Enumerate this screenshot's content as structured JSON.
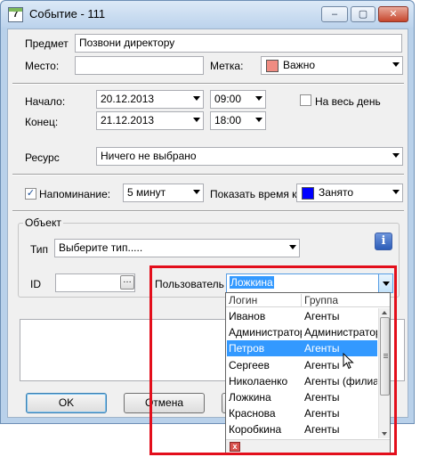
{
  "window": {
    "icon_text": "7",
    "title": "Событие - 111",
    "min_glyph": "–",
    "max_glyph": "▢",
    "close_glyph": "✕"
  },
  "form": {
    "subject_label": "Предмет",
    "subject_value": "Позвони директору",
    "place_label": "Место:",
    "place_value": "",
    "tag_label": "Метка:",
    "tag_value": "Важно",
    "start_label": "Начало:",
    "start_date": "20.12.2013",
    "start_time": "09:00",
    "end_label": "Конец:",
    "end_date": "21.12.2013",
    "end_time": "18:00",
    "allday_label": "На весь день",
    "allday_checked": false,
    "resource_label": "Ресурс",
    "resource_value": "Ничего не выбрано",
    "reminder_label": "Напоминание:",
    "reminder_checked": true,
    "reminder_value": "5 минут",
    "showtime_label": "Показать время ка",
    "showtime_value": "Занято"
  },
  "object": {
    "group_title": "Объект",
    "type_label": "Тип",
    "type_value": "Выберите тип.....",
    "info_glyph": "i",
    "id_label": "ID",
    "id_value": "",
    "browse_glyph": "…",
    "user_label": "Пользователь",
    "user_value": "Ложкина"
  },
  "dropdown": {
    "col_login": "Логин",
    "col_group": "Группа",
    "rows": [
      {
        "login": "Иванов",
        "group": "Агенты"
      },
      {
        "login": "Администратор",
        "group": "Администратор"
      },
      {
        "login": "Петров",
        "group": "Агенты"
      },
      {
        "login": "Сергеев",
        "group": "Агенты"
      },
      {
        "login": "Николаенко",
        "group": "Агенты (филиал)"
      },
      {
        "login": "Ложкина",
        "group": "Агенты"
      },
      {
        "login": "Краснова",
        "group": "Агенты"
      },
      {
        "login": "Коробкина",
        "group": "Агенты"
      }
    ],
    "selected_index": 2,
    "clear_glyph": "x"
  },
  "buttons": {
    "ok": "OK",
    "cancel": "Отмена"
  },
  "colors": {
    "tag_swatch": "#f08c82",
    "busy_swatch": "#0000ff",
    "highlight": "#e30e1b",
    "selection": "#3399ff"
  }
}
